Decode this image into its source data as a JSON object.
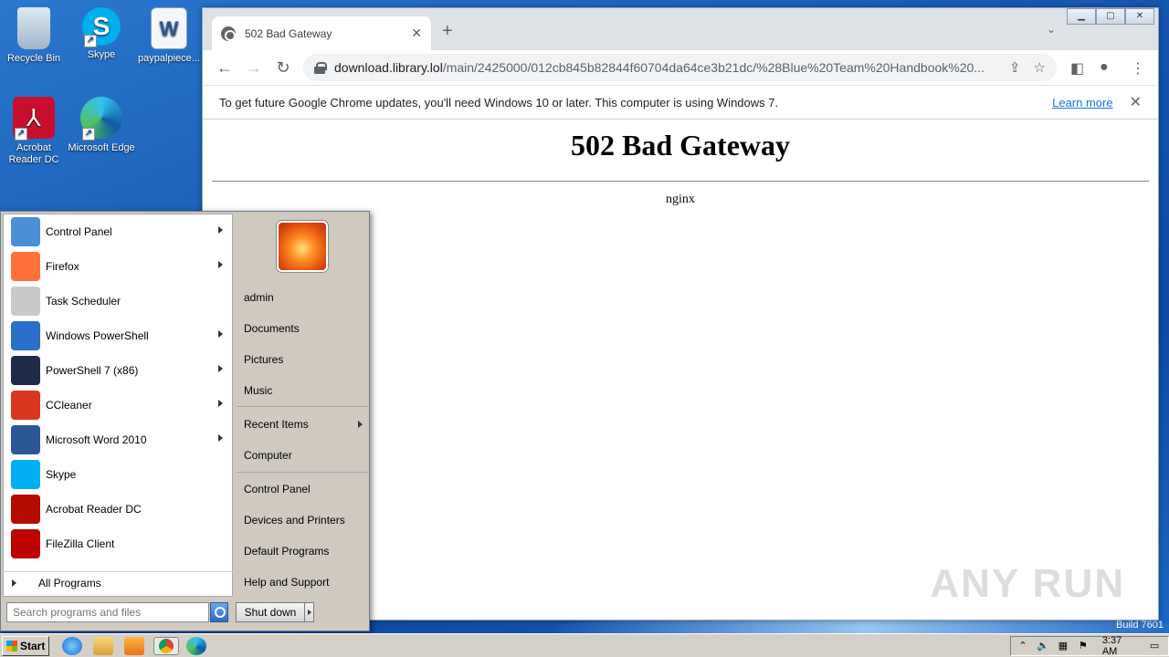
{
  "desktop": {
    "icons": [
      {
        "label": "Recycle Bin"
      },
      {
        "label": "Skype"
      },
      {
        "label": "paypalpiece..."
      },
      {
        "label": "Acrobat Reader DC"
      },
      {
        "label": "Microsoft Edge"
      }
    ],
    "build": "Build 7601"
  },
  "browser": {
    "tab_title": "502 Bad Gateway",
    "url_host": "download.library.lol",
    "url_path": "/main/2425000/012cb845b82844f60704da64ce3b21dc/%28Blue%20Team%20Handbook%20...",
    "infobar": {
      "message": "To get future Google Chrome updates, you'll need Windows 10 or later. This computer is using Windows 7.",
      "link": "Learn more"
    },
    "page": {
      "heading": "502 Bad Gateway",
      "server": "nginx"
    },
    "watermark": "ANY RUN"
  },
  "startmenu": {
    "programs": [
      {
        "label": "Control Panel",
        "has_arrow": true,
        "color": "#4a8fd8"
      },
      {
        "label": "Firefox",
        "has_arrow": true,
        "color": "#ff7139"
      },
      {
        "label": "Task Scheduler",
        "has_arrow": false,
        "color": "#c9c9c9"
      },
      {
        "label": "Windows PowerShell",
        "has_arrow": true,
        "color": "#2a6fc9"
      },
      {
        "label": "PowerShell 7 (x86)",
        "has_arrow": true,
        "color": "#1f2b48"
      },
      {
        "label": "CCleaner",
        "has_arrow": true,
        "color": "#d9381e"
      },
      {
        "label": "Microsoft Word 2010",
        "has_arrow": true,
        "color": "#2b5797"
      },
      {
        "label": "Skype",
        "has_arrow": false,
        "color": "#00aff0"
      },
      {
        "label": "Acrobat Reader DC",
        "has_arrow": false,
        "color": "#b30b00"
      },
      {
        "label": "FileZilla Client",
        "has_arrow": false,
        "color": "#bf0000"
      }
    ],
    "all_programs": "All Programs",
    "search_placeholder": "Search programs and files",
    "right": {
      "user": "admin",
      "documents": "Documents",
      "pictures": "Pictures",
      "music": "Music",
      "recent_items": "Recent Items",
      "computer": "Computer",
      "control_panel": "Control Panel",
      "devices_printers": "Devices and Printers",
      "default_programs": "Default Programs",
      "help_support": "Help and Support"
    },
    "shutdown": "Shut down"
  },
  "taskbar": {
    "start": "Start",
    "clock": "3:37 AM"
  }
}
